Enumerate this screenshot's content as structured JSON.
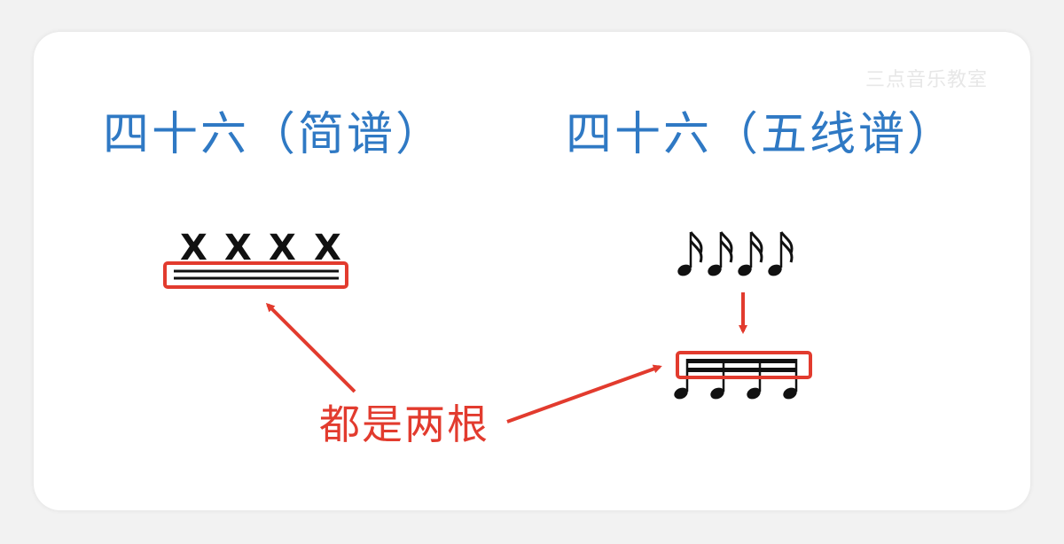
{
  "watermark": "三点音乐教室",
  "headings": {
    "left": "四十六（简谱）",
    "right": "四十六（五线谱）"
  },
  "jianpu": {
    "notes": [
      "X",
      "X",
      "X",
      "X"
    ]
  },
  "caption": "都是两根",
  "colors": {
    "heading": "#2f79c4",
    "accent": "#e23b2e",
    "ink": "#111111"
  }
}
